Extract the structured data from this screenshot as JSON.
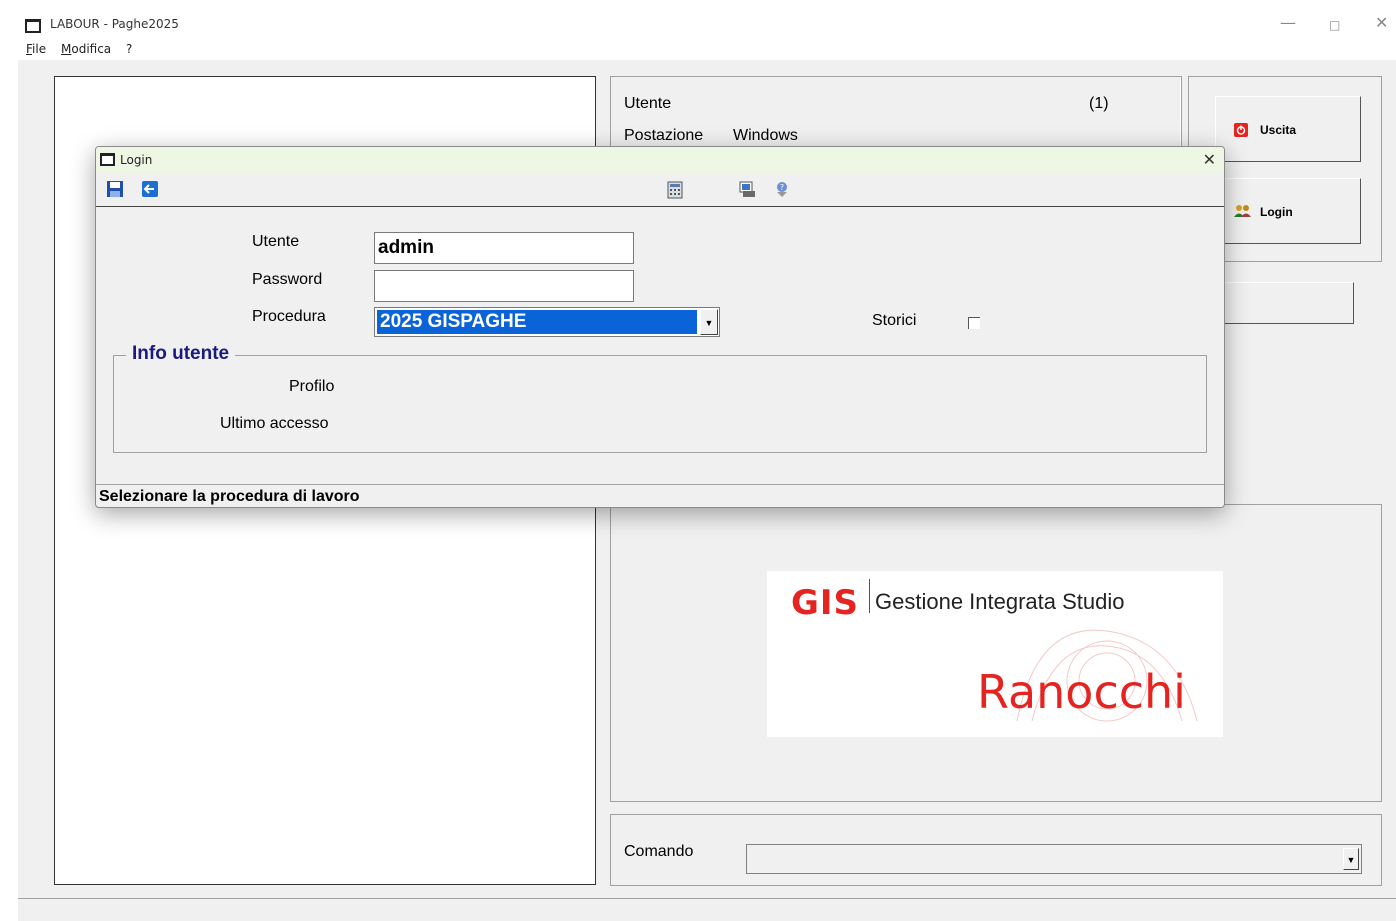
{
  "app": {
    "title": "LABOUR - Paghe2025",
    "menu": [
      {
        "first": "F",
        "rest": "ile"
      },
      {
        "first": "M",
        "rest": "odifica"
      },
      {
        "first": "",
        "rest": "?"
      }
    ]
  },
  "info": {
    "utente_label": "Utente",
    "utente_count": "(1)",
    "postazione_label": "Postazione",
    "postazione_value": "Windows"
  },
  "buttons": {
    "uscita": "Uscita",
    "login": "Login"
  },
  "logo": {
    "mark": "GIS",
    "tagline": "Gestione Integrata Studio",
    "brand": "Ranocchi"
  },
  "comando": {
    "label": "Comando",
    "value": ""
  },
  "dialog": {
    "title": "Login",
    "utente_label": "Utente",
    "utente_value": "admin",
    "password_label": "Password",
    "password_value": "",
    "procedura_label": "Procedura",
    "procedura_value": "2025 GISPAGHE",
    "storici_label": "Storici",
    "storici_checked": false,
    "info_title": "Info utente",
    "profilo_label": "Profilo",
    "ultimo_accesso_label": "Ultimo accesso",
    "status": "Selezionare la procedura di lavoro"
  },
  "icons": [
    "save-icon",
    "back-icon",
    "calculator-icon",
    "print-icon",
    "help-icon",
    "power-icon",
    "users-icon"
  ],
  "colors": {
    "accent_red": "#e52421",
    "selection_blue": "#0a64d8",
    "group_title": "#1a1a80"
  }
}
